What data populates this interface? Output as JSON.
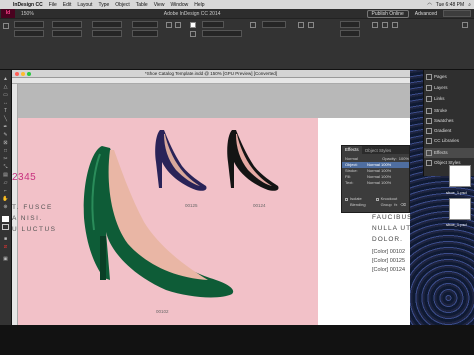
{
  "menubar": {
    "app": "InDesign CC",
    "items": [
      "File",
      "Edit",
      "Layout",
      "Type",
      "Object",
      "Table",
      "View",
      "Window",
      "Help"
    ],
    "clock": "Tue 6:48 PM"
  },
  "appbar": {
    "logo": "Id",
    "zoom": "150%",
    "title": "Adobe InDesign CC 2014",
    "publish": "Publish Online",
    "workspace": "Advanced"
  },
  "document": {
    "title": "*Shoe Catalog Template.indd @ 150% [GPU Preview] [Converted]"
  },
  "page": {
    "number_pink": "2345",
    "left_lines": [
      "T. FUSCE",
      "A NISI.",
      "U LUCTUS"
    ],
    "captions": [
      "00125",
      "00124",
      "00102"
    ],
    "right_lines": [
      "FAUCIBUS",
      "NULLA UT",
      "DOLOR."
    ],
    "tags": [
      "[Color] 00102",
      "[Color] 00125",
      "[Color] 00124"
    ]
  },
  "effects_panel": {
    "tabs": [
      "Effects",
      "Object Styles"
    ],
    "blend_mode": "Normal",
    "opacity_label": "Opacity:",
    "opacity": "100%",
    "rows": [
      {
        "name": "Object:",
        "value": "Normal 100%"
      },
      {
        "name": "Stroke:",
        "value": "Normal 100%"
      },
      {
        "name": "Fill:",
        "value": "Normal 100%"
      },
      {
        "name": "Text:",
        "value": "Normal 100%"
      }
    ],
    "isolate": "Isolate Blending",
    "knockout": "Knockout Group"
  },
  "panel_dock": {
    "items": [
      "Pages",
      "Layers",
      "Links",
      "Stroke",
      "Swatches",
      "Gradient",
      "CC Libraries",
      "Effects",
      "Object Styles"
    ]
  },
  "desktop_files": [
    "shoe_1.psd",
    "shoe_1.psd"
  ],
  "colors": {
    "pink": "#f2c1c8",
    "accent": "#c7317f",
    "shoe_green": "#0e5c37",
    "shoe_purple": "#2a2358",
    "shoe_black": "#141414"
  }
}
